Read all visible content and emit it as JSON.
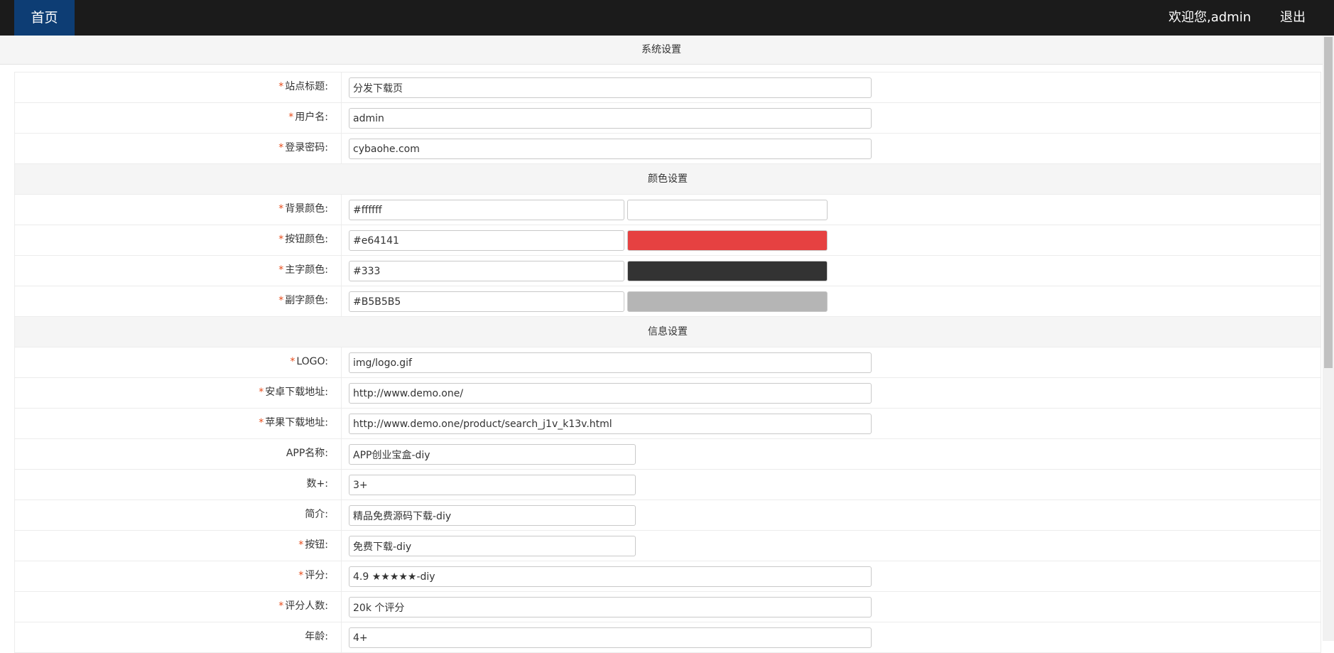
{
  "nav": {
    "home": "首页",
    "welcome": "欢迎您,admin",
    "logout": "退出"
  },
  "system_header": "系统设置",
  "required_mark": "*",
  "site": {
    "title_label": "站点标题:",
    "title_value": "分发下载页",
    "username_label": "用户名:",
    "username_value": "admin",
    "password_label": "登录密码:",
    "password_value": "cybaohe.com"
  },
  "color_header": "颜色设置",
  "colors": {
    "bg_label": "背景颜色:",
    "bg_value": "#ffffff",
    "bg_swatch": "#ffffff",
    "btn_label": "按钮颜色:",
    "btn_value": "#e64141",
    "btn_swatch": "#e64141",
    "main_label": "主字颜色:",
    "main_value": "#333",
    "main_swatch": "#333333",
    "sub_label": "副字颜色:",
    "sub_value": "#B5B5B5",
    "sub_swatch": "#B5B5B5"
  },
  "info_header": "信息设置",
  "info": {
    "logo_label": "LOGO:",
    "logo_value": "img/logo.gif",
    "android_label": "安卓下载地址:",
    "android_value": "http://www.demo.one/",
    "ios_label": "苹果下载地址:",
    "ios_value": "http://www.demo.one/product/search_j1v_k13v.html",
    "appname_label": "APP名称:",
    "appname_value": "APP创业宝盒-diy",
    "count_label": "数+:",
    "count_value": "3+",
    "intro_label": "简介:",
    "intro_value": "精品免费源码下载-diy",
    "button_label": "按钮:",
    "button_value": "免费下载-diy",
    "rating_label": "评分:",
    "rating_value": "4.9 ★★★★★-diy",
    "raters_label": "评分人数:",
    "raters_value": "20k 个评分",
    "age_label": "年龄:",
    "age_value": "4+"
  }
}
